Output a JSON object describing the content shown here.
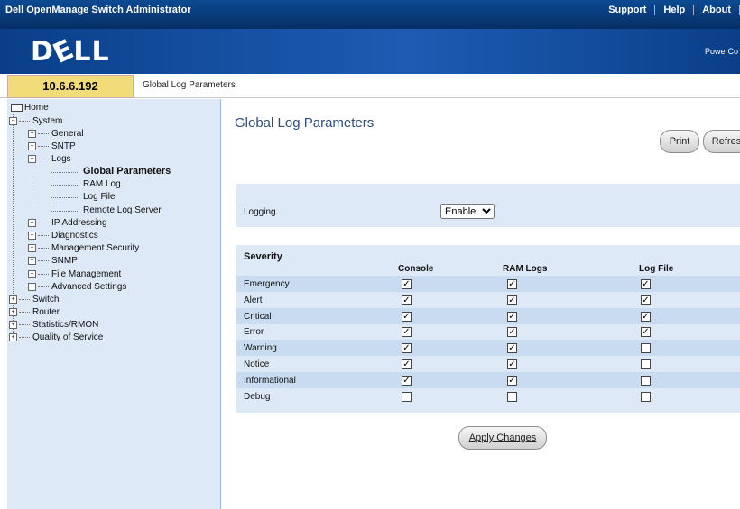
{
  "header": {
    "app_title": "Dell OpenManage Switch Administrator",
    "links": [
      "Support",
      "Help",
      "About"
    ],
    "logo": "DELL",
    "product": "PowerCo"
  },
  "info": {
    "ip": "10.6.6.192",
    "breadcrumb": "Global Log Parameters"
  },
  "sidebar": {
    "home": "Home",
    "system": "System",
    "general": "General",
    "snmp_sys": "SNTP",
    "logs": "Logs",
    "global_params": "Global Parameters",
    "ram_log": "RAM Log",
    "log_file": "Log File",
    "remote_log": "Remote Log Server",
    "ip_addressing": "IP Addressing",
    "diagnostics": "Diagnostics",
    "mgmt_security": "Management Security",
    "snmp": "SNMP",
    "file_mgmt": "File Management",
    "advanced": "Advanced Settings",
    "switch": "Switch",
    "router": "Router",
    "stats": "Statistics/RMON",
    "qos": "Quality of Service"
  },
  "main": {
    "title": "Global Log Parameters",
    "print_label": "Print",
    "refresh_label": "Refres",
    "logging_label": "Logging",
    "logging_value": "Enable",
    "severity_label": "Severity",
    "col_console": "Console",
    "col_ram": "RAM Logs",
    "col_logfile": "Log File",
    "apply_label": "Apply Changes"
  },
  "severity_rows": [
    {
      "name": "Emergency",
      "console": true,
      "ram": true,
      "file": true
    },
    {
      "name": "Alert",
      "console": true,
      "ram": true,
      "file": true
    },
    {
      "name": "Critical",
      "console": true,
      "ram": true,
      "file": true
    },
    {
      "name": "Error",
      "console": true,
      "ram": true,
      "file": true
    },
    {
      "name": "Warning",
      "console": true,
      "ram": true,
      "file": false
    },
    {
      "name": "Notice",
      "console": true,
      "ram": true,
      "file": false
    },
    {
      "name": "Informational",
      "console": true,
      "ram": true,
      "file": false
    },
    {
      "name": "Debug",
      "console": false,
      "ram": false,
      "file": false
    }
  ],
  "colors": {
    "header": "#0a3a7a",
    "ipbox": "#f2dc7a",
    "panel": "#dde9f7",
    "title": "#2c4d7d"
  }
}
